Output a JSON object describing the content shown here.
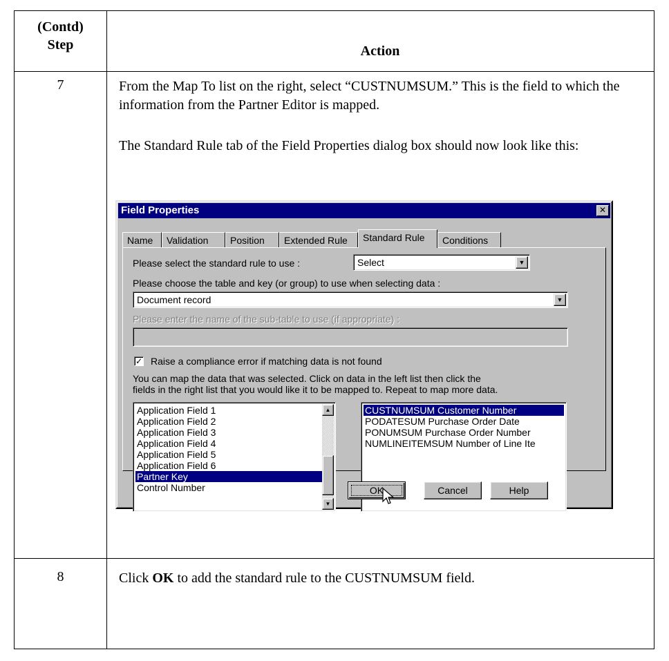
{
  "header": {
    "step_line1": "(Contd)",
    "step_line2": "Step",
    "action": "Action"
  },
  "rows": [
    {
      "step": "7",
      "para1": "From the Map To list on the right, select “CUSTNUMSUM.” This is the field to which the information from the Partner Editor is mapped.",
      "para2": "The Standard Rule tab of the Field Properties dialog box should now look like this:"
    },
    {
      "step": "8",
      "text_pre": "Click ",
      "text_bold": "OK",
      "text_post": " to add the standard rule to the CUSTNUMSUM field."
    }
  ],
  "dialog": {
    "title": "Field Properties",
    "close_glyph": "✕",
    "tabs": [
      "Name",
      "Validation",
      "Position",
      "Extended Rule",
      "Standard Rule",
      "Conditions"
    ],
    "active_tab": "Standard Rule",
    "rule_label": "Please select the standard rule to use :",
    "rule_value": "Select",
    "table_label": "Please choose the table and key (or group) to use when selecting data :",
    "table_value": "Document record",
    "subtable_label": "Please enter the name of the sub-table to use (if appropriate) :",
    "subtable_value": "",
    "compliance_checked": true,
    "compliance_label": "Raise a compliance error if matching data is not found",
    "map_help_line1": "You can map the data that was selected. Click on data in the left list then click the",
    "map_help_line2": "fields in the right list that you would like it to be mapped to. Repeat to map more data.",
    "left_list": [
      "Application Field 1",
      "Application Field 2",
      "Application Field 3",
      "Application Field 4",
      "Application Field 5",
      "Application Field 6",
      "Partner Key",
      "Control Number"
    ],
    "left_selected": "Partner Key",
    "right_list": [
      "CUSTNUMSUM Customer Number",
      "PODATESUM Purchase Order Date",
      "PONUMSUM Purchase Order Number",
      "NUMLINEITEMSUM Number of Line Ite"
    ],
    "right_selected": "CUSTNUMSUM Customer Number",
    "buttons": {
      "ok": "OK",
      "cancel": "Cancel",
      "help": "Help"
    }
  }
}
